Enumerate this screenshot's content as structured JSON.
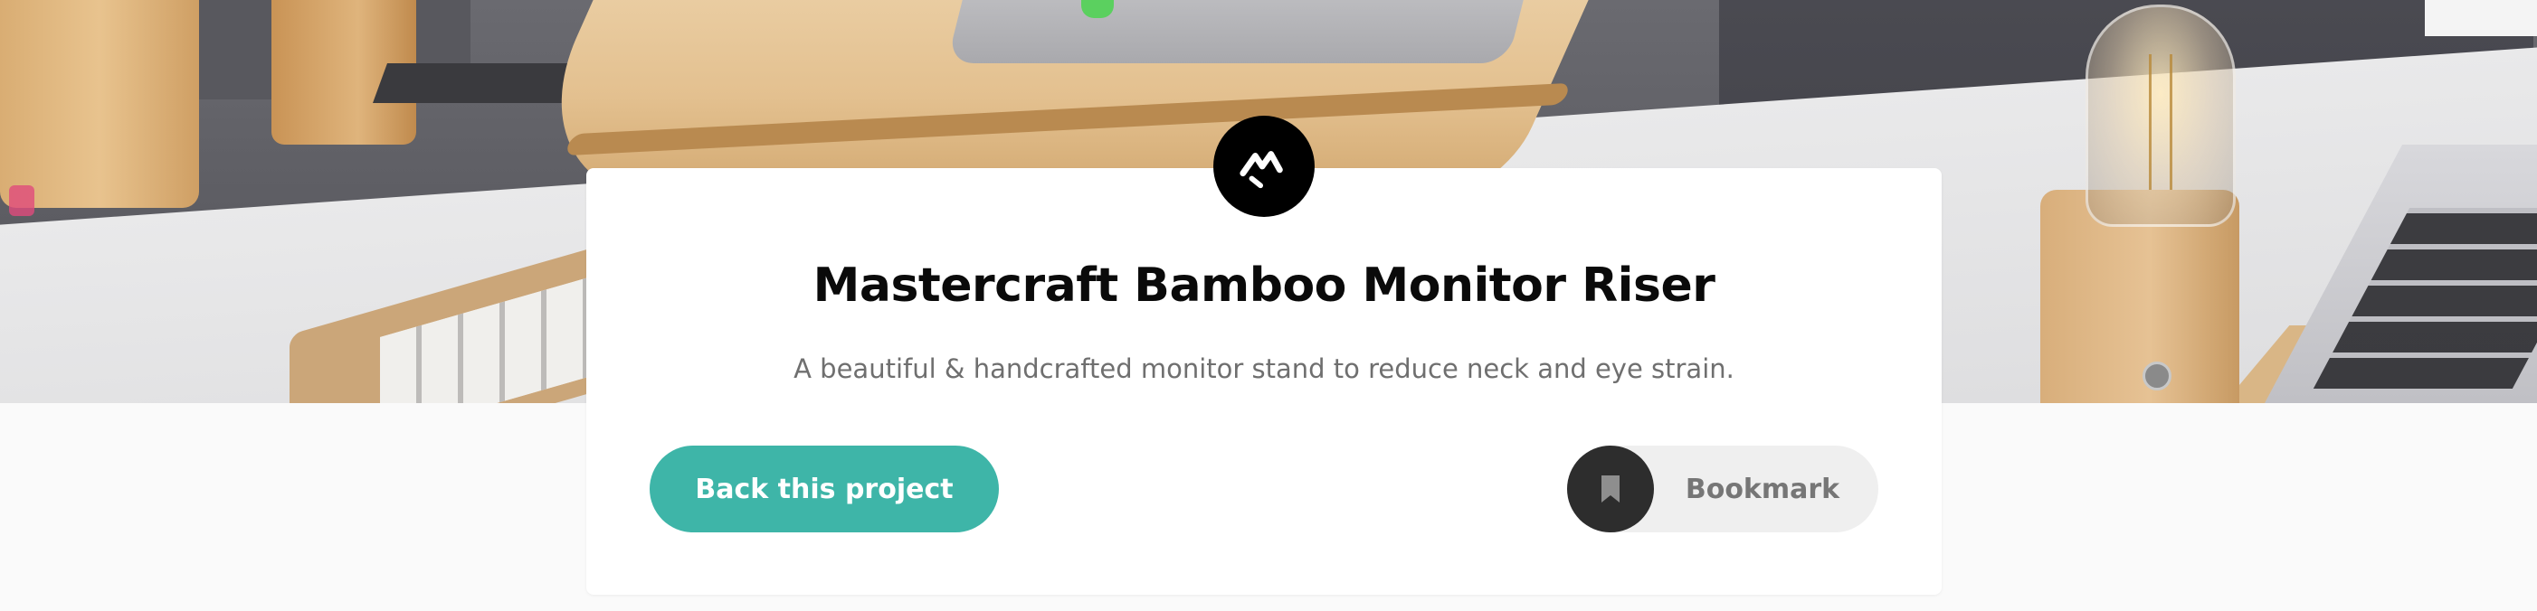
{
  "project": {
    "title": "Mastercraft Bamboo Monitor Riser",
    "subtitle": "A beautiful & handcrafted monitor stand to reduce neck and eye strain."
  },
  "actions": {
    "back_label": "Back this project",
    "bookmark_label": "Bookmark"
  },
  "icons": {
    "logo": "brand-logo-icon",
    "bookmark": "bookmark-icon"
  },
  "colors": {
    "accent": "#3eb5a8",
    "title": "#0a0a0a",
    "subtitle": "#6f6f6f",
    "bookmark_bg": "#efefef",
    "bookmark_circle": "#2d2d2d",
    "logo_bg": "#000000"
  }
}
